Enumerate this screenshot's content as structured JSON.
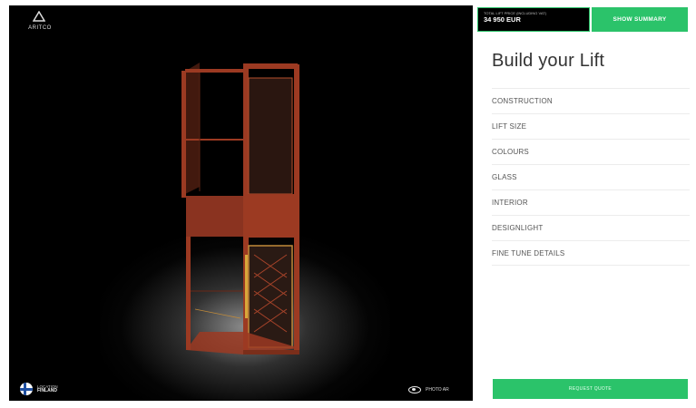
{
  "brand": {
    "name": "ARITCO"
  },
  "location": {
    "label": "LOCATION",
    "country": "FINLAND"
  },
  "photo_ar": {
    "label": "PHOTO AR"
  },
  "price": {
    "label": "TOTAL LIFT PRICE (INCLUDING VAT)",
    "value": "34 950 EUR"
  },
  "header": {
    "summary_label": "SHOW SUMMARY"
  },
  "panel": {
    "title": "Build your Lift",
    "menu": [
      {
        "label": "CONSTRUCTION"
      },
      {
        "label": "LIFT SIZE"
      },
      {
        "label": "COLOURS"
      },
      {
        "label": "GLASS"
      },
      {
        "label": "INTERIOR"
      },
      {
        "label": "DESIGNLIGHT"
      },
      {
        "label": "FINE TUNE DETAILS"
      }
    ],
    "request_label": "REQUEST QUOTE"
  },
  "colors": {
    "accent": "#2bc36a",
    "lift_frame": "#9c3a22",
    "viewport_bg": "#000000"
  }
}
